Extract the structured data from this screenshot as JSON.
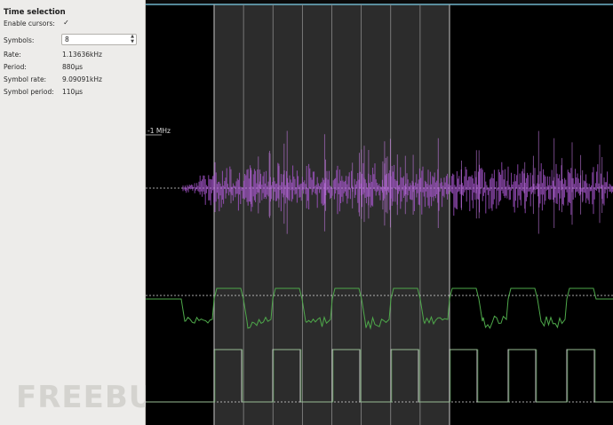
{
  "panel": {
    "title": "Time selection",
    "rows": [
      {
        "label": "Enable cursors:",
        "value": "✓"
      },
      {
        "label": "Symbols:",
        "value": "8"
      },
      {
        "label": "Rate:",
        "value": "1.13636kHz"
      },
      {
        "label": "Period:",
        "value": "880µs"
      },
      {
        "label": "Symbol rate:",
        "value": "9.09091kHz"
      },
      {
        "label": "Symbol period:",
        "value": "110µs"
      }
    ],
    "symbols_spin_up": "▲",
    "symbols_spin_down": "▼",
    "watermark": "FREEBUF"
  },
  "plot": {
    "freq_label": "-1 MHz",
    "colors": {
      "selection": "#505050",
      "cursor_line": "#8a8a8a",
      "spectrum": "#b05ad8",
      "signal": "#4ea84a",
      "top_bar": "#6fb3c9"
    }
  }
}
